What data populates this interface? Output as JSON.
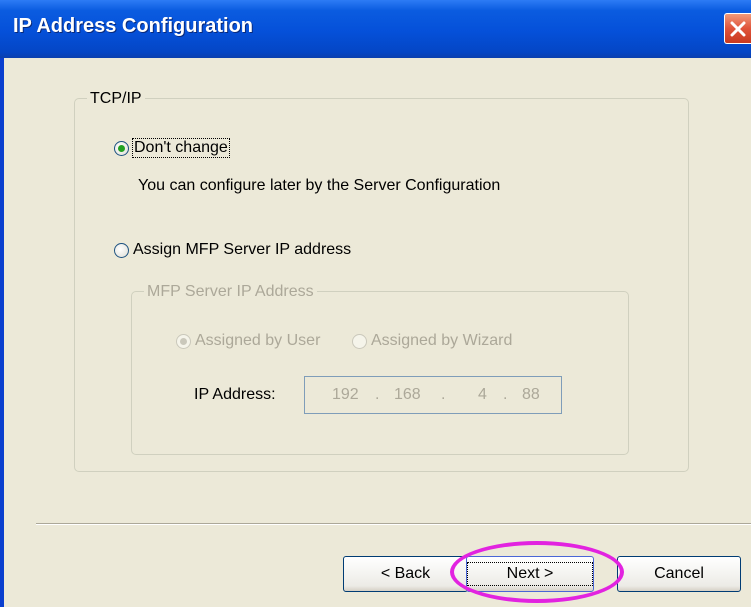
{
  "window": {
    "title": "IP Address Configuration"
  },
  "tcpip_group": {
    "label": "TCP/IP",
    "dont_change_label": "Don't change",
    "dont_change_note": "You can configure later by the Server Configuration",
    "assign_label": "Assign MFP Server IP address"
  },
  "mfp_group": {
    "label": "MFP Server IP Address",
    "assigned_by_user_label": "Assigned by User",
    "assigned_by_wizard_label": "Assigned by Wizard",
    "ip_label": "IP Address:",
    "ip_octets": [
      "192",
      "168",
      "4",
      "88"
    ],
    "ip_dots": [
      ".",
      ".",
      "."
    ]
  },
  "buttons": {
    "back_label": "< Back",
    "next_label": "Next >",
    "cancel_label": "Cancel"
  },
  "colors": {
    "highlight": "#e223e0",
    "titlebar": "#0550d9"
  }
}
